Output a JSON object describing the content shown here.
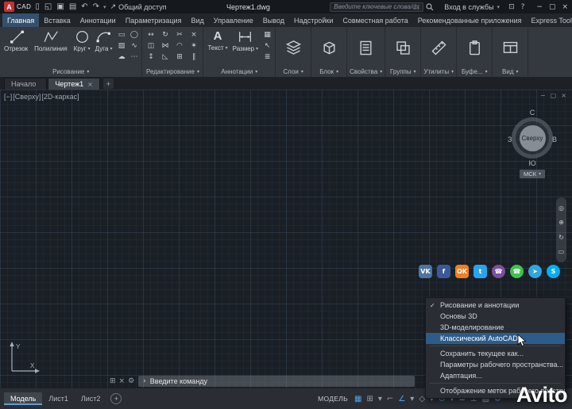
{
  "ui": {
    "caret_down": "▾"
  },
  "titlebar": {
    "logo_letter": "A",
    "logo_text": "CAD",
    "qat_icons": [
      {
        "name": "new-file-icon",
        "glyph": "▯"
      },
      {
        "name": "open-folder-icon",
        "glyph": "◱"
      },
      {
        "name": "save-icon",
        "glyph": "▣"
      },
      {
        "name": "plot-icon",
        "glyph": "▤"
      },
      {
        "name": "undo-icon",
        "glyph": "↶"
      },
      {
        "name": "redo-icon",
        "glyph": "↷"
      }
    ],
    "share_icon": "↗",
    "share_label": "Общий доступ",
    "doc_title": "Чертеж1.dwg",
    "search_placeholder": "Введите ключевые слова/фразу",
    "signin_label": "Вход в службы",
    "right_icons": [
      {
        "name": "app-store-icon",
        "glyph": "⊡"
      },
      {
        "name": "help-icon",
        "glyph": "?"
      }
    ],
    "window_icons": [
      {
        "name": "window-minimize-icon",
        "glyph": "−"
      },
      {
        "name": "window-restore-icon",
        "glyph": "▢"
      },
      {
        "name": "window-close-icon",
        "glyph": "×"
      }
    ]
  },
  "ribbon_tabs": [
    {
      "label": "Главная",
      "active": true
    },
    {
      "label": "Вставка"
    },
    {
      "label": "Аннотации"
    },
    {
      "label": "Параметризация"
    },
    {
      "label": "Вид"
    },
    {
      "label": "Управление"
    },
    {
      "label": "Вывод"
    },
    {
      "label": "Надстройки"
    },
    {
      "label": "Совместная работа"
    },
    {
      "label": "Рекомендованные приложения"
    },
    {
      "label": "Express Tools"
    }
  ],
  "ribbon": {
    "draw": {
      "label": "Рисование",
      "buttons": [
        {
          "label": "Отрезок"
        },
        {
          "label": "Полилиния"
        },
        {
          "label": "Круг",
          "caret": "▾"
        },
        {
          "label": "Дуга",
          "caret": "▾"
        }
      ],
      "minis": [
        {
          "name": "rectangle-icon",
          "glyph": "▭"
        },
        {
          "name": "ellipse-icon",
          "glyph": "◯"
        },
        {
          "name": "hatch-icon",
          "glyph": "▨"
        },
        {
          "name": "spline-icon",
          "glyph": "∿"
        },
        {
          "name": "revision-cloud-icon",
          "glyph": "☁"
        },
        {
          "name": "more-draw-icon",
          "glyph": "⋯"
        }
      ]
    },
    "modify": {
      "label": "Редактирование",
      "minis": [
        {
          "name": "move-icon",
          "glyph": "↔"
        },
        {
          "name": "rotate-icon",
          "glyph": "↻"
        },
        {
          "name": "trim-icon",
          "glyph": "✂"
        },
        {
          "name": "erase-icon",
          "glyph": "×"
        },
        {
          "name": "copy-icon",
          "glyph": "◫"
        },
        {
          "name": "mirror-icon",
          "glyph": "⋈"
        },
        {
          "name": "fillet-icon",
          "glyph": "◠"
        },
        {
          "name": "explode-icon",
          "glyph": "✶"
        },
        {
          "name": "stretch-icon",
          "glyph": "↕"
        },
        {
          "name": "scale-icon",
          "glyph": "◺"
        },
        {
          "name": "array-icon",
          "glyph": "⊞"
        },
        {
          "name": "offset-icon",
          "glyph": "∥"
        }
      ]
    },
    "annotate": {
      "label": "Аннотации",
      "text_button": {
        "label": "Текст",
        "letter": "A",
        "caret": "▾"
      },
      "dim_button": {
        "label": "Размер",
        "caret": "▾"
      },
      "minis": [
        {
          "name": "table-icon",
          "glyph": "▦"
        },
        {
          "name": "leader-icon",
          "glyph": "↖"
        },
        {
          "name": "text-style-icon",
          "glyph": "≣"
        }
      ]
    },
    "collapsed_panels": [
      {
        "label": "Слои"
      },
      {
        "label": "Блок"
      },
      {
        "label": "Свойства"
      },
      {
        "label": "Группы"
      },
      {
        "label": "Утилиты"
      },
      {
        "label": "Буфе..."
      },
      {
        "label": "Вид"
      }
    ]
  },
  "file_tabs": {
    "tabs": [
      {
        "label": "Начало"
      },
      {
        "label": "Чертеж1",
        "active": true,
        "close": "×"
      }
    ],
    "add_label": "+"
  },
  "canvas": {
    "viewport_controls": [
      "[−]",
      "[Сверху]",
      "[2D-каркас]"
    ],
    "window_icons": [
      {
        "name": "viewport-minimize-icon",
        "glyph": "−"
      },
      {
        "name": "viewport-restore-icon",
        "glyph": "▢"
      },
      {
        "name": "viewport-close-icon",
        "glyph": "×"
      }
    ],
    "viewcube": {
      "north": "С",
      "west": "З",
      "east": "В",
      "south": "Ю",
      "face": "Сверху",
      "wcs": "МСК"
    },
    "navbar_icons": [
      {
        "name": "navigation-wheel-icon",
        "glyph": "◎"
      },
      {
        "name": "zoom-icon",
        "glyph": "⊕"
      },
      {
        "name": "orbit-icon",
        "glyph": "↻"
      },
      {
        "name": "showmotion-icon",
        "glyph": "▭"
      }
    ],
    "ucs": {
      "x": "X",
      "y": "Y"
    }
  },
  "social_icons": [
    {
      "name": "vk-icon",
      "glyph": "VK",
      "color": "#4c75a3"
    },
    {
      "name": "facebook-icon",
      "glyph": "f",
      "color": "#3b5998"
    },
    {
      "name": "odnoklassniki-icon",
      "glyph": "OK",
      "color": "#f07f1f"
    },
    {
      "name": "twitter-icon",
      "glyph": "t",
      "color": "#29a3ef"
    },
    {
      "name": "viber-icon",
      "glyph": "☎",
      "color": "#7b519d",
      "round": true
    },
    {
      "name": "whatsapp-icon",
      "glyph": "☎",
      "color": "#3fc351",
      "round": true
    },
    {
      "name": "telegram-icon",
      "glyph": "➤",
      "color": "#2fa6dc",
      "round": true
    },
    {
      "name": "skype-icon",
      "glyph": "S",
      "color": "#00aff0",
      "round": true
    }
  ],
  "workspace_menu": {
    "items": [
      {
        "label": "Рисование и аннотации",
        "check": "✓"
      },
      {
        "label": "Основы 3D"
      },
      {
        "label": "3D-моделирование"
      },
      {
        "label": "Классический AutoCAD",
        "highlighted": true,
        "separator_after": true
      },
      {
        "label": "Сохранить текущее как..."
      },
      {
        "label": "Параметры рабочего пространства..."
      },
      {
        "label": "Адаптация...",
        "separator_after": true
      },
      {
        "label": "Отображение меток рабочего пространства"
      }
    ]
  },
  "command_line": {
    "icons": [
      {
        "name": "recent-commands-icon",
        "glyph": "⊞"
      },
      {
        "name": "close-commandline-icon",
        "glyph": "×"
      },
      {
        "name": "tools-icon",
        "glyph": "⚙"
      }
    ],
    "caret": "›",
    "prompt": "Введите команду"
  },
  "layout_tabs": [
    {
      "label": "Модель",
      "active": true
    },
    {
      "label": "Лист1"
    },
    {
      "label": "Лист2"
    }
  ],
  "statusbar": {
    "add_layout": "+",
    "model_label": "МОДЕЛЬ",
    "icons": [
      {
        "name": "grid-display-icon",
        "glyph": "▦",
        "active": true
      },
      {
        "name": "snap-mode-icon",
        "glyph": "⊞"
      },
      {
        "name": "chevron-down-icon",
        "glyph": "▾"
      },
      {
        "name": "ortho-mode-icon",
        "glyph": "⌐"
      },
      {
        "name": "polar-tracking-icon",
        "glyph": "∠",
        "active": true
      },
      {
        "name": "chevron-down-icon",
        "glyph": "▾"
      },
      {
        "name": "isodraft-icon",
        "glyph": "◇"
      },
      {
        "name": "chevron-down-icon",
        "glyph": "▾"
      },
      {
        "name": "object-snap-icon",
        "glyph": "⊙",
        "active": true
      },
      {
        "name": "chevron-down-icon",
        "glyph": "▾"
      },
      {
        "name": "lineweight-icon",
        "glyph": "≡"
      },
      {
        "name": "dynamic-ucs-icon",
        "glyph": "⊥"
      },
      {
        "name": "transparency-icon",
        "glyph": "▨"
      },
      {
        "name": "settings-gear-icon",
        "glyph": "⚙",
        "active": true
      }
    ]
  },
  "watermark": "Avito"
}
